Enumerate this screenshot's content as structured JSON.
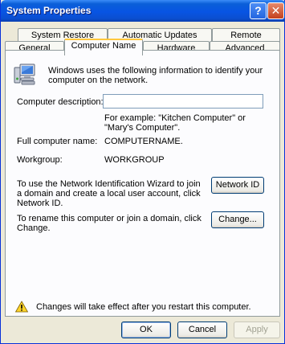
{
  "window": {
    "title": "System Properties",
    "help_label": "?",
    "close_label": "✕"
  },
  "tabs": {
    "row1": [
      "System Restore",
      "Automatic Updates",
      "Remote"
    ],
    "row2": [
      "General",
      "Computer Name",
      "Hardware",
      "Advanced"
    ],
    "active": "Computer Name"
  },
  "panel": {
    "intro": "Windows uses the following information to identify your computer on the network.",
    "description_label": "Computer description:",
    "description_value": "",
    "example": "For example: \"Kitchen Computer\" or \"Mary's Computer\".",
    "full_name_label": "Full computer name:",
    "full_name_value": "COMPUTERNAME.",
    "workgroup_label": "Workgroup:",
    "workgroup_value": "WORKGROUP",
    "network_id_text": "To use the Network Identification Wizard to join a domain and create a local user account, click Network ID.",
    "network_id_button": "Network ID",
    "rename_text": "To rename this computer or join a domain, click Change.",
    "change_button": "Change...",
    "warning": "Changes will take effect after you restart this computer."
  },
  "footer": {
    "ok": "OK",
    "cancel": "Cancel",
    "apply": "Apply"
  },
  "icons": [
    "computer-icon",
    "warning-icon",
    "help-icon",
    "close-icon"
  ]
}
